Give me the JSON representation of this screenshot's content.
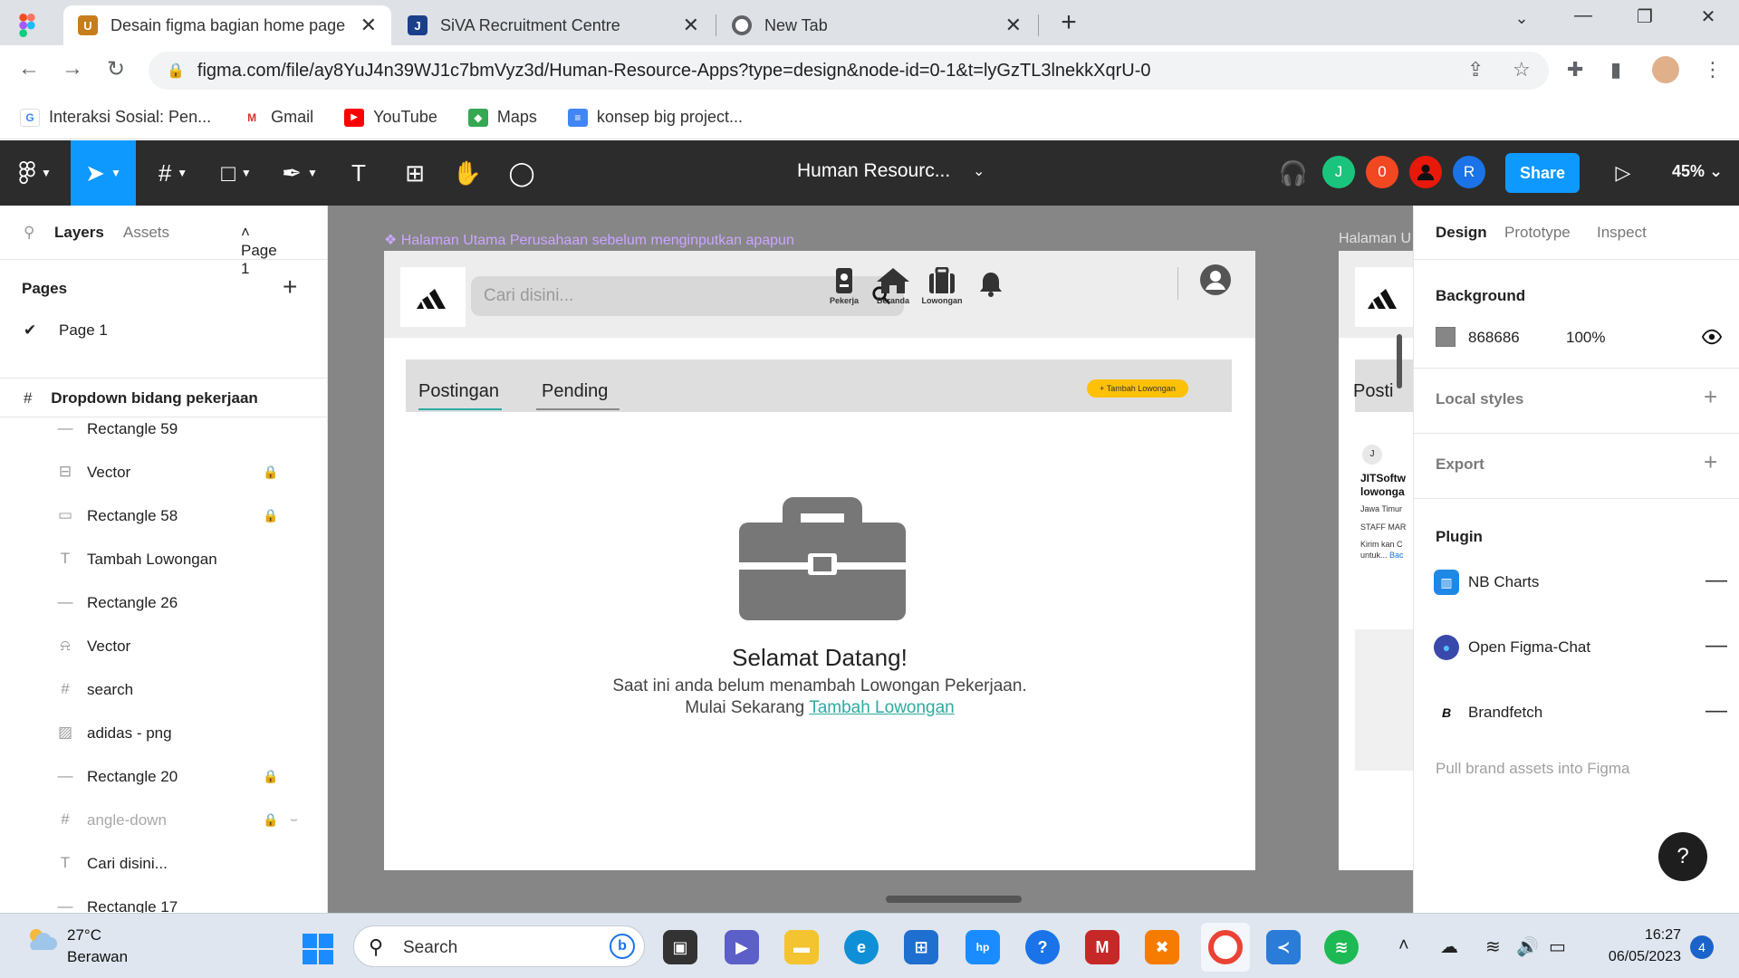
{
  "browser": {
    "tabs": [
      {
        "title": "Desain figma bagian home page",
        "favicon": "U"
      },
      {
        "title": "SiVA Recruitment Centre",
        "favicon": "J"
      },
      {
        "title": "New Tab",
        "favicon": ""
      }
    ],
    "new_tab": "+",
    "url": "figma.com/file/ay8YuJ4n39WJ1c7bmVyz3d/Human-Resource-Apps?type=design&node-id=0-1&t=lyGzTL3lnekkXqrU-0",
    "bookmarks": [
      {
        "label": "Interaksi Sosial: Pen...",
        "icon": "G"
      },
      {
        "label": "Gmail",
        "icon": "M"
      },
      {
        "label": "YouTube",
        "icon": "▶"
      },
      {
        "label": "Maps",
        "icon": "◆"
      },
      {
        "label": "konsep big project...",
        "icon": "≡"
      }
    ]
  },
  "figma": {
    "file_title": "Human Resourc...",
    "avatars": [
      "J",
      "0",
      "",
      "R"
    ],
    "share_label": "Share",
    "zoom": "45%"
  },
  "left_panel": {
    "tabs": {
      "layers": "Layers",
      "assets": "Assets",
      "page": "Page 1"
    },
    "pages_title": "Pages",
    "pages": [
      "Page 1"
    ],
    "frame_name": "Dropdown bidang pekerjaan",
    "layers": [
      {
        "name": "Rectangle 59",
        "icon": "—",
        "locked": false,
        "hidden": false
      },
      {
        "name": "Vector",
        "icon": "⊟",
        "locked": true,
        "hidden": false
      },
      {
        "name": "Rectangle 58",
        "icon": "▭",
        "locked": true,
        "hidden": false
      },
      {
        "name": "Tambah Lowongan",
        "icon": "T",
        "locked": false,
        "hidden": false
      },
      {
        "name": "Rectangle 26",
        "icon": "—",
        "locked": false,
        "hidden": false
      },
      {
        "name": "Vector",
        "icon": "⍾",
        "locked": false,
        "hidden": false
      },
      {
        "name": "search",
        "icon": "#",
        "locked": false,
        "hidden": false
      },
      {
        "name": "adidas - png",
        "icon": "▨",
        "locked": false,
        "hidden": false
      },
      {
        "name": "Rectangle 20",
        "icon": "—",
        "locked": true,
        "hidden": false
      },
      {
        "name": "angle-down",
        "icon": "#",
        "locked": true,
        "hidden": true
      },
      {
        "name": "Cari disini...",
        "icon": "T",
        "locked": false,
        "hidden": false
      },
      {
        "name": "Rectangle 17",
        "icon": "—",
        "locked": false,
        "hidden": false
      }
    ]
  },
  "canvas": {
    "frame_label": "❖ Halaman Utama Perusahaan sebelum menginputkan apapun",
    "frame2_label": "Halaman U",
    "search_placeholder": "Cari disini...",
    "nav": [
      "Pekerja",
      "Beranda",
      "Lowongan"
    ],
    "tabs": [
      "Postingan",
      "Pending"
    ],
    "tambah_button": "+ Tambah Lowongan",
    "welcome_title": "Selamat Datang!",
    "welcome_sub": "Saat ini anda belum menambah Lowongan Pekerjaan.",
    "welcome_cta_prefix": "Mulai Sekarang",
    "welcome_cta_link": "Tambah Lowongan",
    "frame2": {
      "tab": "Posti",
      "card_title": "JITSoftw lowonga",
      "card_loc": "Jawa Timur",
      "card_role": "STAFF MAR",
      "card_desc1": "Kirim kan C",
      "card_desc2": "untuk...",
      "card_more": "Bac"
    }
  },
  "right_panel": {
    "tabs": [
      "Design",
      "Prototype",
      "Inspect"
    ],
    "background_title": "Background",
    "background_hex": "868686",
    "background_opacity": "100%",
    "local_styles": "Local styles",
    "export": "Export",
    "plugin_title": "Plugin",
    "plugins": [
      {
        "name": "NB Charts",
        "color": "#1e88e5",
        "icon": "▥"
      },
      {
        "name": "Open Figma-Chat",
        "color": "#3949ab",
        "icon": "●"
      },
      {
        "name": "Brandfetch",
        "color": "#ffffff",
        "icon": "B"
      }
    ],
    "brandfetch_desc": "Pull brand assets into Figma",
    "help": "?"
  },
  "taskbar": {
    "temp": "27°C",
    "condition": "Berawan",
    "search": "Search",
    "time": "16:27",
    "date": "06/05/2023",
    "notifications": "4"
  },
  "colors": {
    "figma_dark": "#2c2c2c",
    "figma_blue": "#0d99ff",
    "canvas_bg": "#868686",
    "accent_teal": "#2eaaa0",
    "button_yellow": "#ffc107"
  }
}
